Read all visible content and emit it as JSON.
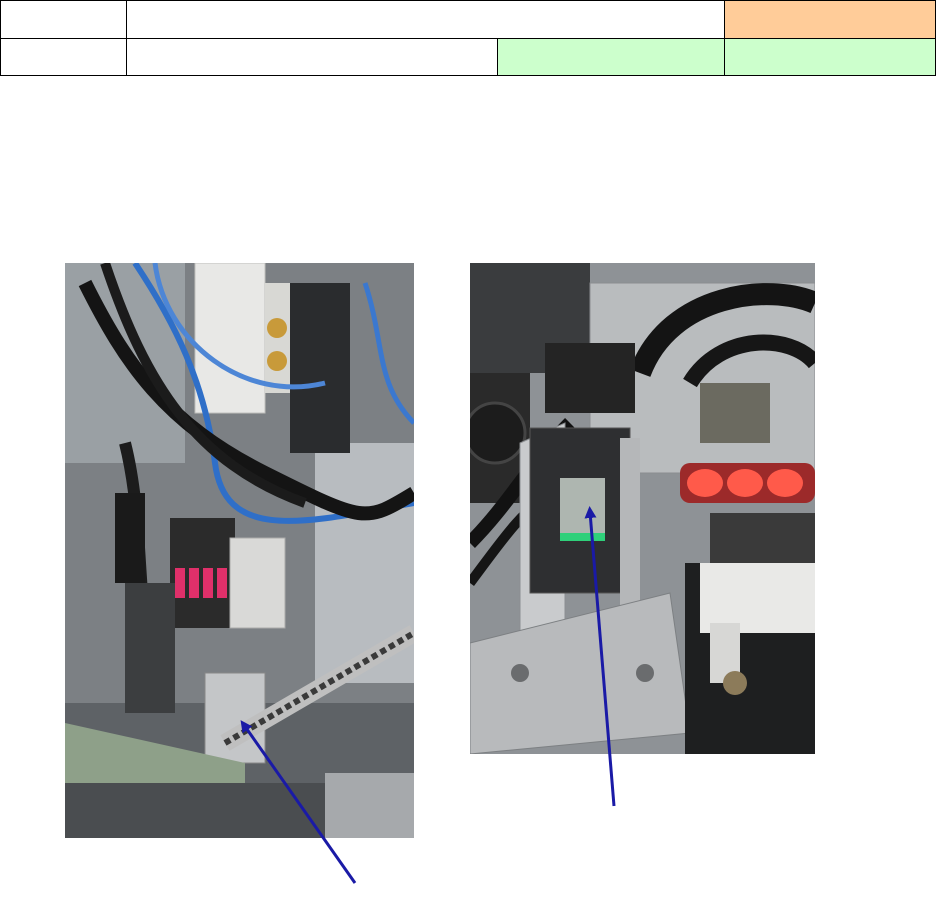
{
  "table": {
    "row1": {
      "col1": "",
      "col2": "",
      "col3": ""
    },
    "row2": {
      "col1": "",
      "col2": "",
      "col3": "",
      "col4": ""
    },
    "colors": {
      "orange": "#ffcc99",
      "green": "#ccffcc"
    }
  },
  "photos": {
    "left": {
      "subject": "machine-valve-assembly-photo"
    },
    "right": {
      "subject": "machine-bracket-sensor-photo"
    }
  },
  "arrow_color": "#1a1aa6"
}
